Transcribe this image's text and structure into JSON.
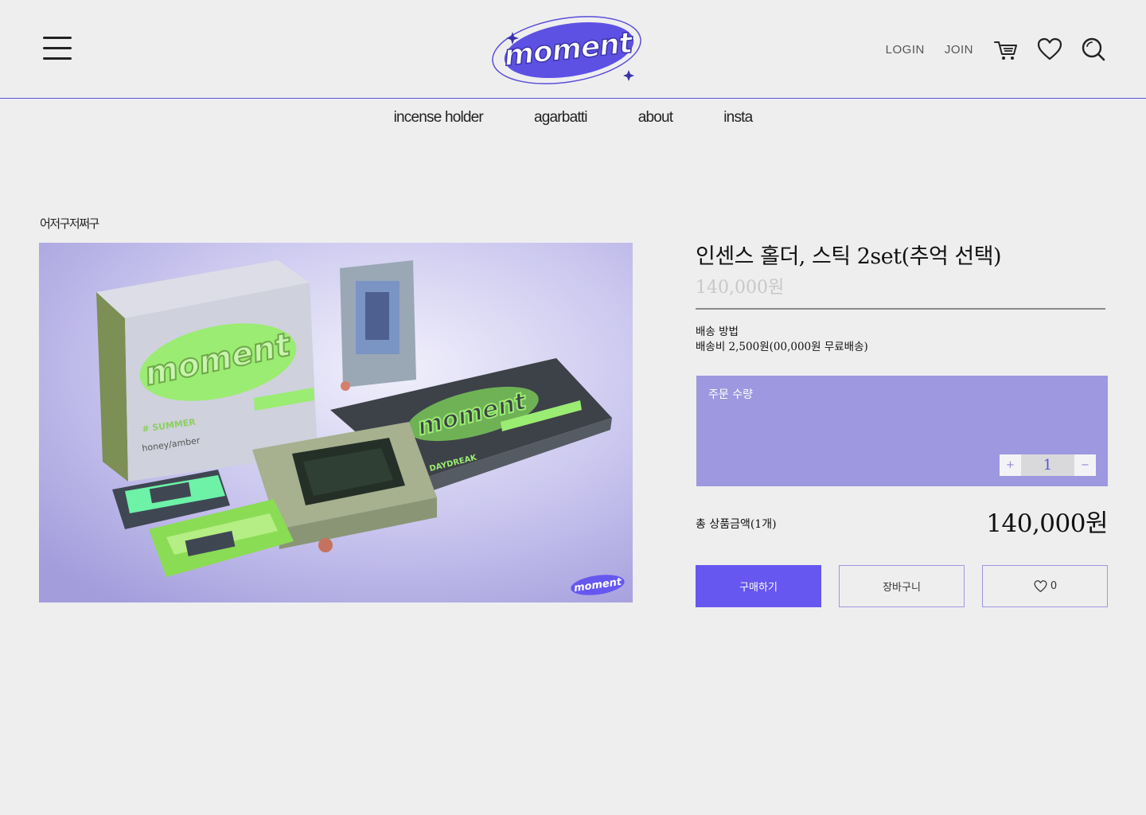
{
  "header": {
    "logo_text": "moment",
    "links": {
      "login": "LOGIN",
      "join": "JOIN"
    },
    "icons": [
      "menu-icon",
      "cart-icon",
      "heart-icon",
      "search-icon"
    ]
  },
  "nav": {
    "items": [
      "incense holder",
      "agarbatti",
      "about",
      "insta"
    ]
  },
  "breadcrumb": "어저구저쩌구",
  "product": {
    "title": "인센스 홀더, 스틱 2set(추억 선택)",
    "price": "140,000원",
    "shipping_label": "배송 방법",
    "shipping_value": "배송비 2,500원(00,000원 무료배송)",
    "image_texts": [
      "moment",
      "# SUMMER",
      "honey/amber",
      "# DAYDREAK"
    ]
  },
  "order": {
    "qty_label": "주문 수량",
    "plus": "+",
    "minus": "−",
    "quantity": "1"
  },
  "total": {
    "label": "총 상품금액(1개)",
    "value": "140,000원"
  },
  "buttons": {
    "buy": "구매하기",
    "cart": "장바구니",
    "like_count": "0"
  },
  "colors": {
    "brand": "#6657f0",
    "accent_lavender": "#9d98df",
    "background": "#eeeeef"
  }
}
